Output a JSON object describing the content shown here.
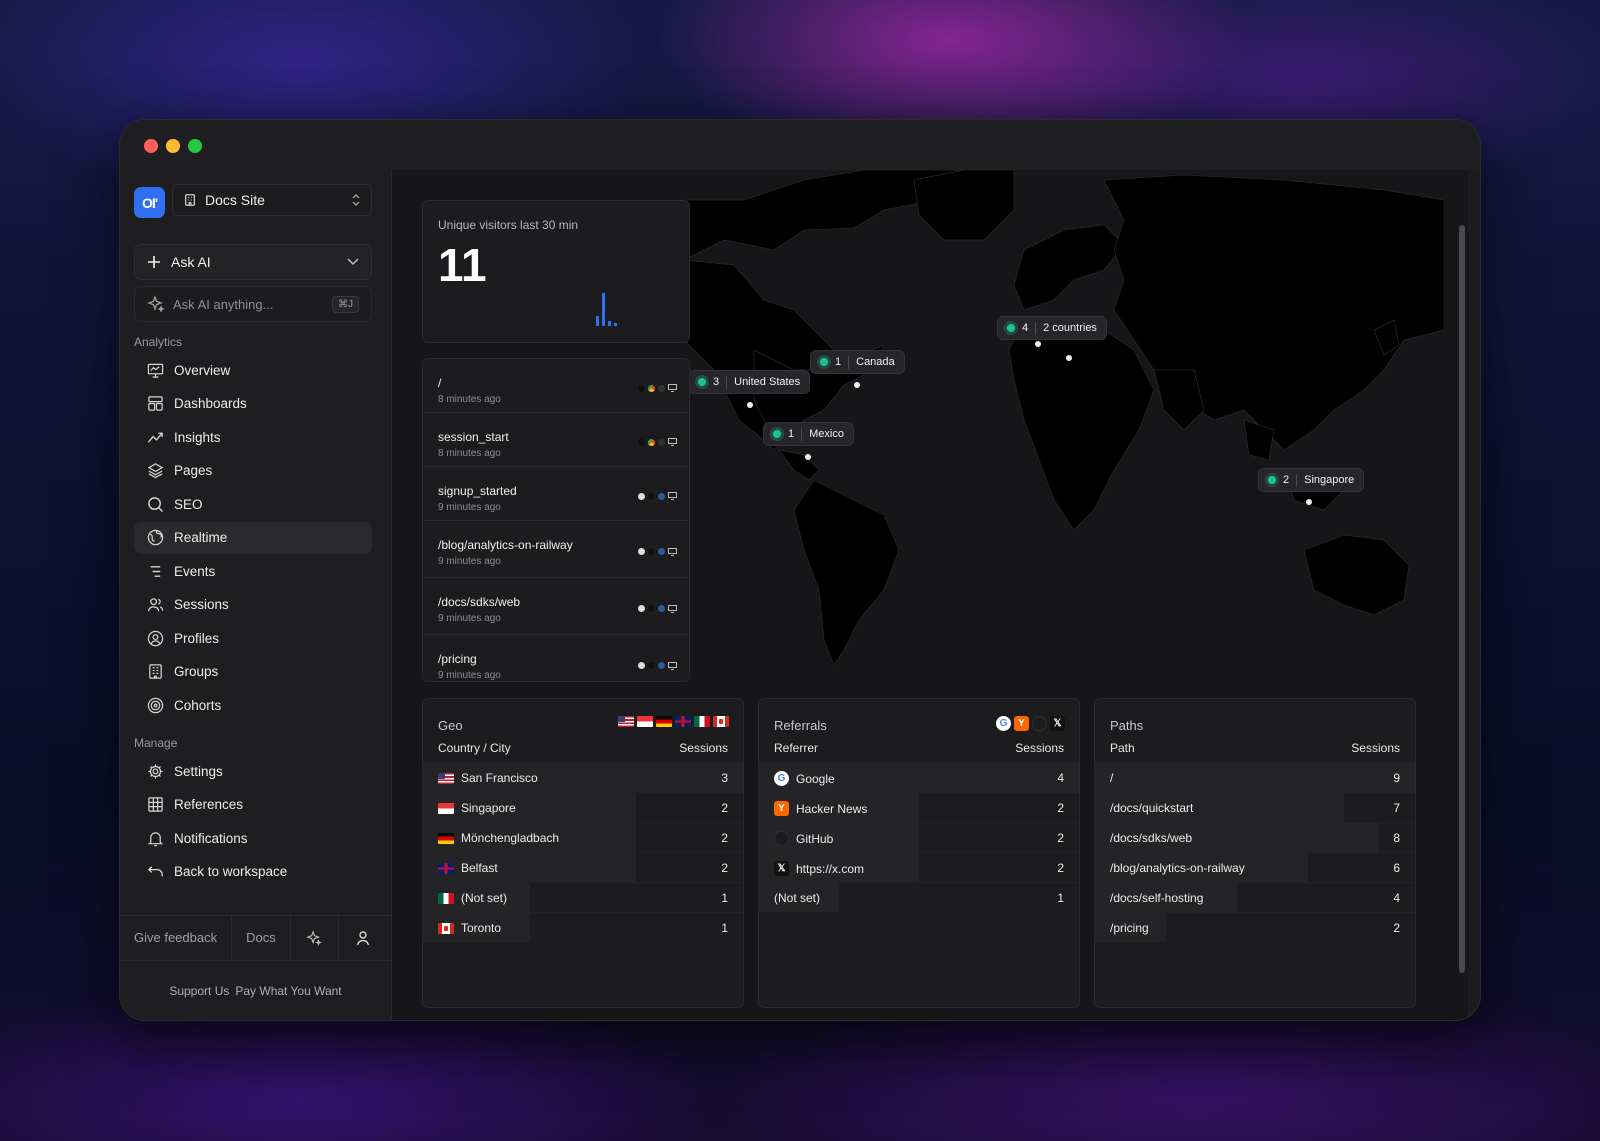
{
  "workspace": {
    "logo_text": "OI'",
    "site_name": "Docs Site"
  },
  "ask_ai": {
    "button_label": "Ask AI",
    "input_placeholder": "Ask AI anything...",
    "shortcut": "⌘J"
  },
  "sidebar": {
    "analytics_label": "Analytics",
    "analytics_items": [
      {
        "label": "Overview",
        "icon": "monitor-icon"
      },
      {
        "label": "Dashboards",
        "icon": "dashboard-icon"
      },
      {
        "label": "Insights",
        "icon": "trend-icon"
      },
      {
        "label": "Pages",
        "icon": "layers-icon"
      },
      {
        "label": "SEO",
        "icon": "search-icon"
      },
      {
        "label": "Realtime",
        "icon": "globe-icon",
        "active": true
      },
      {
        "label": "Events",
        "icon": "events-icon"
      },
      {
        "label": "Sessions",
        "icon": "users-icon"
      },
      {
        "label": "Profiles",
        "icon": "user-circle-icon"
      },
      {
        "label": "Groups",
        "icon": "building-icon"
      },
      {
        "label": "Cohorts",
        "icon": "target-icon"
      }
    ],
    "manage_label": "Manage",
    "manage_items": [
      {
        "label": "Settings",
        "icon": "gear-icon"
      },
      {
        "label": "References",
        "icon": "grid-icon"
      },
      {
        "label": "Notifications",
        "icon": "bell-icon"
      },
      {
        "label": "Back to workspace",
        "icon": "undo-icon"
      }
    ],
    "footer": {
      "feedback": "Give feedback",
      "docs": "Docs"
    },
    "support": {
      "a": "Support Us",
      "b": "Pay What You Want"
    }
  },
  "realtime": {
    "unique_label": "Unique visitors last 30 min",
    "unique_count": "11",
    "feed": [
      {
        "path": "/",
        "time": "8 minutes ago"
      },
      {
        "path": "session_start",
        "time": "8 minutes ago"
      },
      {
        "path": "signup_started",
        "time": "9 minutes ago"
      },
      {
        "path": "/blog/analytics-on-railway",
        "time": "9 minutes ago"
      },
      {
        "path": "/docs/sdks/web",
        "time": "9 minutes ago"
      },
      {
        "path": "/pricing",
        "time": "9 minutes ago"
      }
    ],
    "map_labels": [
      {
        "count": "4",
        "name": "2 countries"
      },
      {
        "count": "1",
        "name": "Canada"
      },
      {
        "count": "3",
        "name": "United States"
      },
      {
        "count": "1",
        "name": "Mexico"
      },
      {
        "count": "2",
        "name": "Singapore"
      }
    ]
  },
  "geo": {
    "title": "Geo",
    "col_left": "Country / City",
    "col_right": "Sessions",
    "rows": [
      {
        "name": "San Francisco",
        "flag": "us",
        "value": 3
      },
      {
        "name": "Singapore",
        "flag": "sg",
        "value": 2
      },
      {
        "name": "Mönchengladbach",
        "flag": "de",
        "value": 2
      },
      {
        "name": "Belfast",
        "flag": "gb",
        "value": 2
      },
      {
        "name": "(Not set)",
        "flag": "mx",
        "value": 1
      },
      {
        "name": "Toronto",
        "flag": "ca",
        "value": 1
      }
    ]
  },
  "referrals": {
    "title": "Referrals",
    "col_left": "Referrer",
    "col_right": "Sessions",
    "rows": [
      {
        "name": "Google",
        "icon": "google-icon",
        "value": 4
      },
      {
        "name": "Hacker News",
        "icon": "hackernews-icon",
        "value": 2
      },
      {
        "name": "GitHub",
        "icon": "github-icon",
        "value": 2
      },
      {
        "name": "https://x.com",
        "icon": "x-icon",
        "value": 2
      },
      {
        "name": "(Not set)",
        "icon": "",
        "value": 1
      }
    ]
  },
  "paths": {
    "title": "Paths",
    "col_left": "Path",
    "col_right": "Sessions",
    "rows": [
      {
        "name": "/",
        "value": 9
      },
      {
        "name": "/docs/quickstart",
        "value": 7
      },
      {
        "name": "/docs/sdks/web",
        "value": 8
      },
      {
        "name": "/blog/analytics-on-railway",
        "value": 6
      },
      {
        "name": "/docs/self-hosting",
        "value": 4
      },
      {
        "name": "/pricing",
        "value": 2
      }
    ]
  },
  "colors": {
    "accent": "#2f6ff0",
    "live_green": "#1fc48a"
  }
}
